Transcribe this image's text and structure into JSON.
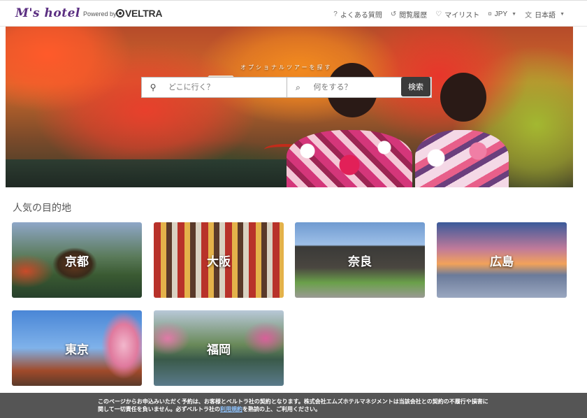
{
  "header": {
    "logo": "M's hotel",
    "powered_by": "Powered by",
    "veltra": "VELTRA",
    "nav": [
      {
        "icon": "question-circle-icon",
        "glyph": "?",
        "label": "よくある質問"
      },
      {
        "icon": "history-icon",
        "glyph": "↺",
        "label": "閲覧履歴"
      },
      {
        "icon": "heart-icon",
        "glyph": "♡",
        "label": "マイリスト"
      },
      {
        "icon": "currency-icon",
        "glyph": "¤",
        "label": "JPY"
      },
      {
        "icon": "language-icon",
        "glyph": "文",
        "label": "日本語"
      }
    ]
  },
  "hero": {
    "caption": "オプショナルツアーを探す",
    "search": {
      "where_placeholder": "どこに行く？",
      "what_placeholder": "何をする？",
      "button_label": "検索"
    }
  },
  "destinations": {
    "title": "人気の目的地",
    "items": [
      "京都",
      "大阪",
      "奈良",
      "広島",
      "東京",
      "福岡"
    ]
  },
  "notice": {
    "text_before": "このページからお申込みいただく予約は、お客様とベルトラ社の契約となります。株式会社エムズホテルマネジメントは当該会社との契約の不履行や損害に関して一切責任を負いません。必ずベルトラ社の",
    "link": "利用規約",
    "text_after": "を熟読の上、ご利用ください。"
  },
  "colors": {
    "logo": "#5b2f82",
    "search_button": "#3b3b3b",
    "notice_bg": "#555555",
    "notice_link": "#8fc4ff"
  }
}
